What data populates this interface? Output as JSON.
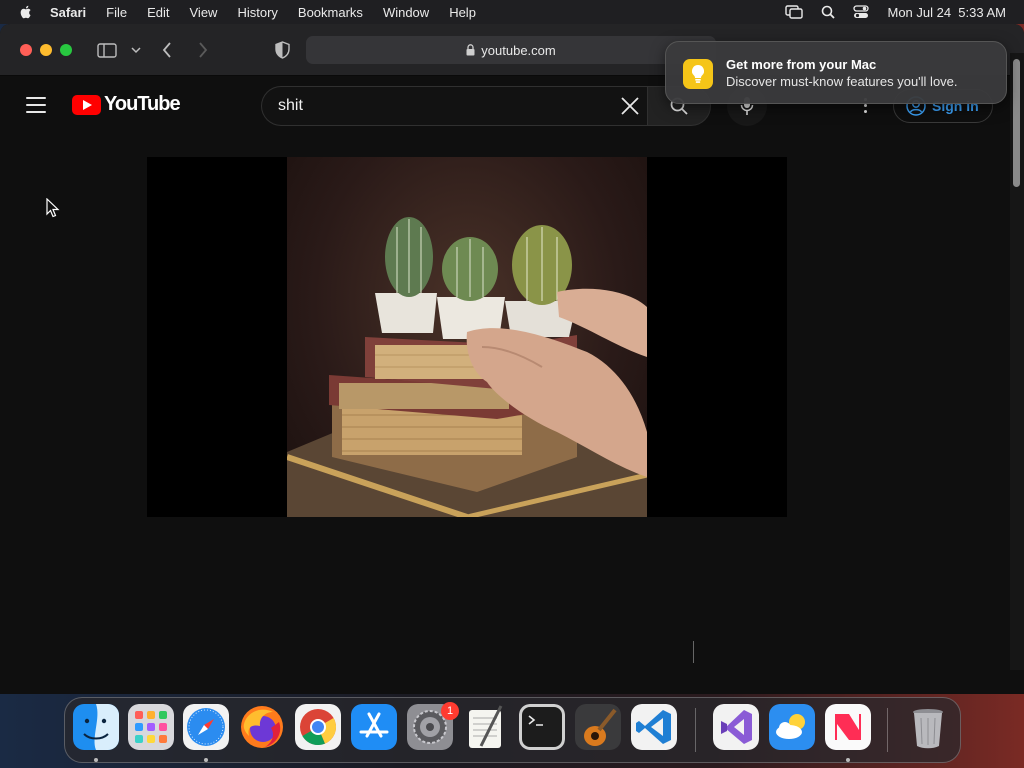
{
  "menubar": {
    "app_name": "Safari",
    "items": [
      "File",
      "Edit",
      "View",
      "History",
      "Bookmarks",
      "Window",
      "Help"
    ],
    "clock": "Mon Jul 24  5:33 AM"
  },
  "safari": {
    "url": "youtube.com"
  },
  "youtube": {
    "logo_text": "YouTube",
    "search_value": "shit",
    "signin_label": "Sign in"
  },
  "notification": {
    "title": "Get more from your Mac",
    "body": "Discover must-know features you'll love."
  },
  "dock": {
    "apps": [
      "Finder",
      "Launchpad",
      "Safari",
      "Firefox",
      "Chrome",
      "App Store",
      "System Settings",
      "TextEdit",
      "Terminal",
      "GarageBand",
      "Visual Studio Code",
      "Visual Studio",
      "Weather",
      "News",
      "Trash"
    ],
    "settings_badge": "1"
  },
  "colors": {
    "youtube_red": "#ff0000",
    "signin_blue": "#3ea6ff",
    "tips_yellow": "#f5c518"
  }
}
